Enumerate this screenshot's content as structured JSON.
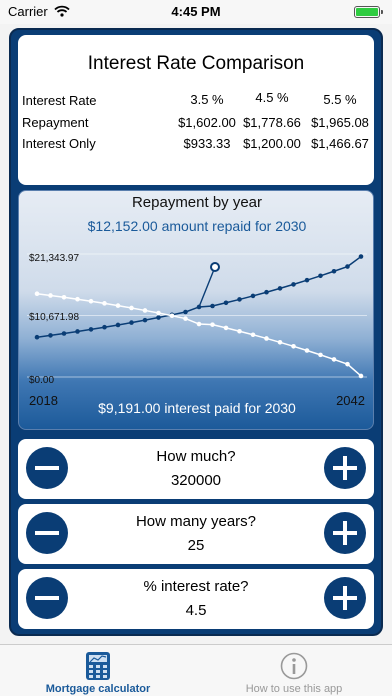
{
  "status": {
    "carrier": "Carrier",
    "time": "4:45 PM"
  },
  "comparison": {
    "title": "Interest Rate Comparison",
    "columns": [
      "3.5 %",
      "4.5 %",
      "5.5 %"
    ],
    "rows": [
      {
        "label": "Interest Rate",
        "values": [
          "3.5 %",
          "4.5 %",
          "5.5 %"
        ]
      },
      {
        "label": "Repayment",
        "values": [
          "$1,602.00",
          "$1,778.66",
          "$1,965.08"
        ]
      },
      {
        "label": "Interest Only",
        "values": [
          "$933.33",
          "$1,200.00",
          "$1,466.67"
        ]
      }
    ]
  },
  "chart": {
    "title": "Repayment by year",
    "repaid_annotation": "$12,152.00 amount repaid for 2030",
    "interest_annotation": "$9,191.00 interest paid for 2030",
    "y_ticks": [
      "$21,343.97",
      "$10,671.98",
      "$0.00"
    ],
    "x_start_label": "2018",
    "x_end_label": "2042"
  },
  "chart_data": {
    "type": "line",
    "title": "Repayment by year",
    "x": [
      2018,
      2019,
      2020,
      2021,
      2022,
      2023,
      2024,
      2025,
      2026,
      2027,
      2028,
      2029,
      2030,
      2031,
      2032,
      2033,
      2034,
      2035,
      2036,
      2037,
      2038,
      2039,
      2040,
      2041,
      2042
    ],
    "xlim": [
      2018,
      2042
    ],
    "ylim": [
      0,
      21343.97
    ],
    "series": [
      {
        "values": [
          6900,
          7220,
          7550,
          7900,
          8260,
          8640,
          9030,
          9440,
          9870,
          10320,
          10790,
          11280,
          12152,
          12320,
          12880,
          13460,
          14070,
          14710,
          15380,
          16070,
          16800,
          17560,
          18350,
          19170,
          20900
        ]
      },
      {
        "values": [
          14450,
          14150,
          13830,
          13500,
          13150,
          12780,
          12390,
          11980,
          11550,
          11100,
          10630,
          10140,
          9191,
          9080,
          8520,
          7940,
          7330,
          6690,
          6020,
          5330,
          4600,
          3840,
          3050,
          2230,
          180
        ]
      }
    ],
    "highlight": {
      "x": 2030,
      "repaid": 12152.0,
      "interest": 9191.0
    },
    "colors": {
      "repaid": "#0a3d75",
      "interest": "#ffffff"
    }
  },
  "steppers": [
    {
      "label": "How much?",
      "value": "320000"
    },
    {
      "label": "How many years?",
      "value": "25"
    },
    {
      "label": "% interest rate?",
      "value": "4.5"
    }
  ],
  "tabs": [
    {
      "label": "Mortgage calculator",
      "icon": "calculator-icon",
      "active": true
    },
    {
      "label": "How to use this app",
      "icon": "info-icon",
      "active": false
    }
  ],
  "colors": {
    "primary": "#0a3d75",
    "active_tab": "#1a5a9a",
    "inactive_tab": "#999999",
    "battery": "#2ecc40"
  }
}
